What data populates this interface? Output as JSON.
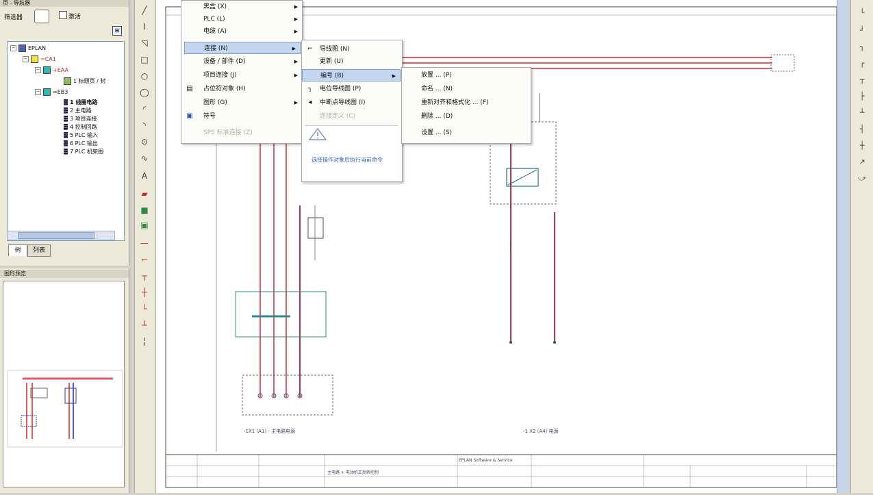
{
  "navigator": {
    "title": "页 - 导航器",
    "filter_label": "筛选器",
    "checkbox_label": "激活",
    "tree": [
      {
        "label": "EPLAN",
        "level": 0
      },
      {
        "label": "=CA1",
        "level": 1
      },
      {
        "label": "+EAA",
        "level": 2
      },
      {
        "label": "1 标题页 / 封",
        "level": 3
      },
      {
        "label": "=EB3",
        "level": 2
      },
      {
        "label": "1 线圈电路",
        "level": 3,
        "bold": true
      },
      {
        "label": "2 主电路",
        "level": 3
      },
      {
        "label": "3 项目连接",
        "level": 3
      },
      {
        "label": "4 控制回路",
        "level": 3
      },
      {
        "label": "5 PLC 输入",
        "level": 3
      },
      {
        "label": "6 PLC 输出",
        "level": 3
      },
      {
        "label": "7 PLC 机架图",
        "level": 3
      }
    ],
    "tabs": [
      "树",
      "列表"
    ]
  },
  "preview": {
    "title": "图形预览"
  },
  "menus": {
    "main": [
      {
        "label": "黑盒 (X)",
        "arrow": true
      },
      {
        "label": "PLC (L)",
        "arrow": true
      },
      {
        "label": "电缆 (A)",
        "arrow": true
      },
      {
        "label": "连接 (N)",
        "arrow": true,
        "highlight": true
      },
      {
        "label": "设备 / 部件 (D)",
        "arrow": true
      },
      {
        "label": "项目连接 (J)",
        "arrow": true
      },
      {
        "label": "占位符对象 (H)",
        "arrow": false
      },
      {
        "label": "图形 (G)",
        "arrow": true
      },
      {
        "label": "符号",
        "arrow": false
      },
      {
        "label": "SPS 标准连接 (Z)",
        "arrow": false,
        "disabled": true
      }
    ],
    "sub1": [
      {
        "label": "导线图 (N)",
        "icon": "wire-icon"
      },
      {
        "label": "更新 (U)",
        "icon": ""
      },
      {
        "label": "编号 (B)",
        "icon": "",
        "highlight": true,
        "arrow": true
      },
      {
        "label": "电位导线图 (P)",
        "icon": "potential-icon"
      },
      {
        "label": "中断点导线图 (I)",
        "icon": "interrupt-icon"
      },
      {
        "label": "连接定义 (C)",
        "icon": "",
        "disabled": true
      }
    ],
    "sub1_info": "选择操作对象后执行当前命令",
    "sub2": [
      {
        "label": "放置 ... (P)"
      },
      {
        "label": "命名 ... (N)"
      },
      {
        "label": "重新对齐和格式化 ... (F)"
      },
      {
        "label": "删除 ... (D)"
      },
      {
        "label": "设置 ... (S)"
      }
    ]
  },
  "drawing": {
    "label_left": "-1X1 (A1) - 主电路电源",
    "label_right": "-1 X2 (A4) 电源",
    "title_block_1": "EPLAN Software & Service",
    "title_block_2": "主电路 + 电动机正反转控制"
  },
  "colors": {
    "wire": "#e05a60",
    "wire_dark": "#c03040",
    "highlight": "#c5d6f0"
  }
}
